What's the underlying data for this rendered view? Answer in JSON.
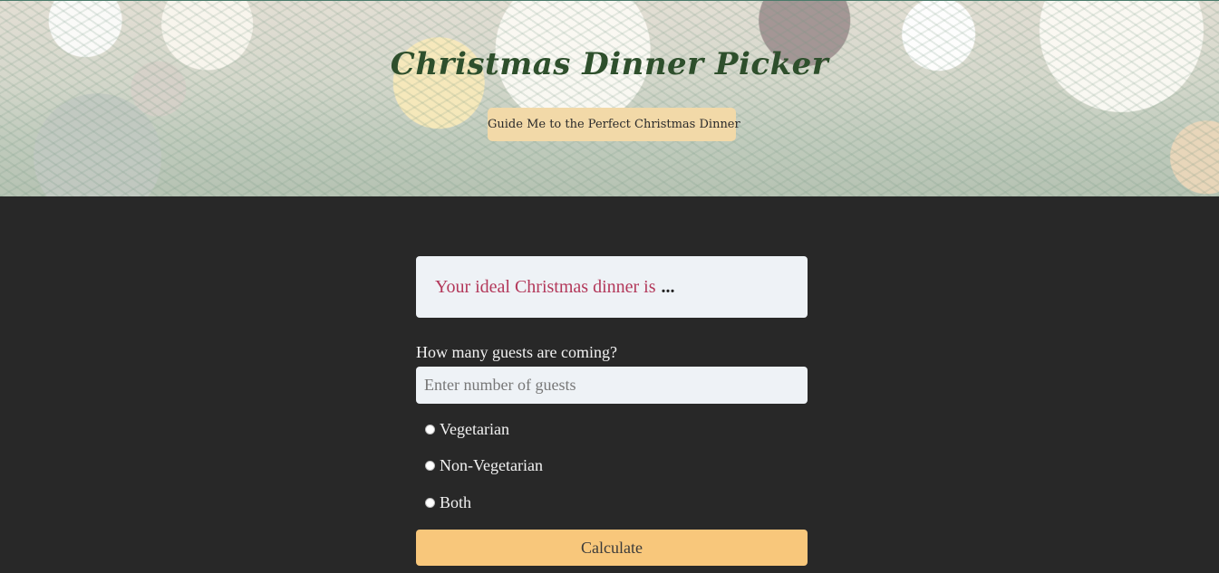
{
  "hero": {
    "title": "Christmas Dinner Picker",
    "guide_button_label": "Guide Me to the Perfect Christmas Dinner"
  },
  "result": {
    "prefix": "Your ideal Christmas dinner is",
    "value": "..."
  },
  "guests": {
    "label": "How many guests are coming?",
    "placeholder": "Enter number of guests",
    "value": ""
  },
  "diet_options": [
    {
      "label": "Vegetarian",
      "selected": false
    },
    {
      "label": "Non-Vegetarian",
      "selected": false
    },
    {
      "label": "Both",
      "selected": false
    }
  ],
  "calculate_label": "Calculate",
  "colors": {
    "background": "#282828",
    "accent": "#f8c77b",
    "title_green": "#2e4f2c",
    "result_text": "#b3385a",
    "field_bg": "#eef2f6"
  }
}
